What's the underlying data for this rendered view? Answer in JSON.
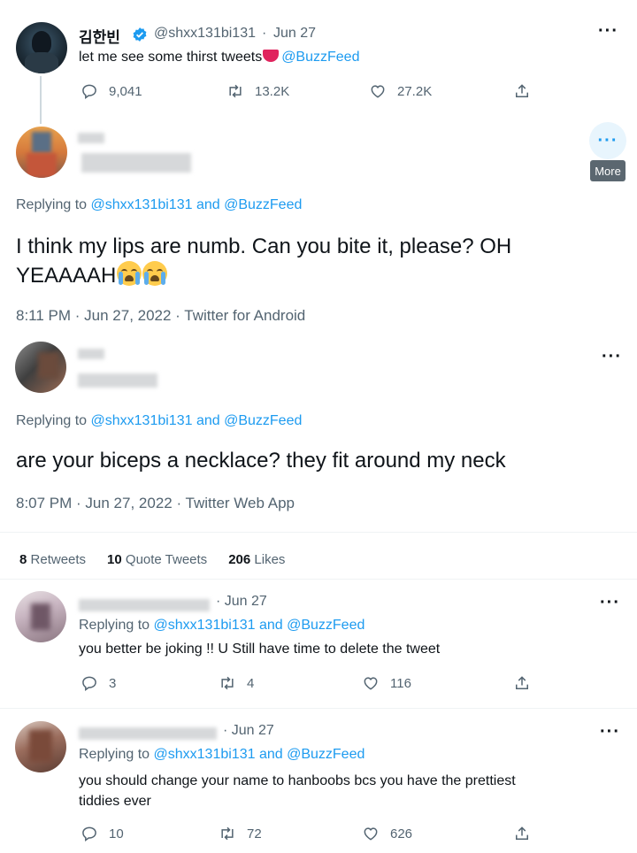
{
  "tweet1": {
    "name": "김한빈",
    "handle": "@shxx131bi131",
    "dot": "·",
    "date": "Jun 27",
    "text": "let me see some thirst tweets",
    "mention": "@BuzzFeed",
    "replies": "9,041",
    "retweets": "13.2K",
    "likes": "27.2K"
  },
  "main_tweet": {
    "replying_prefix": "Replying to",
    "replying_user1": "@shxx131bi131",
    "replying_and": "and",
    "replying_user2": "@BuzzFeed",
    "text_line1": "I think my lips are numb. Can you bite it, please? OH",
    "text_line2": "YEAAAAH",
    "timestamp": "8:11 PM · Jun 27, 2022 · Twitter for Android",
    "more_tooltip": "More"
  },
  "reply_target": {
    "replying_prefix": "Replying to",
    "replying_user1": "@shxx131bi131",
    "replying_and": "and",
    "replying_user2": "@BuzzFeed",
    "text": "are your biceps a necklace? they fit around my neck",
    "timestamp": "8:07 PM · Jun 27, 2022 · Twitter Web App"
  },
  "stats": {
    "retweets_count": "8",
    "retweets_label": "Retweets",
    "quotes_count": "10",
    "quotes_label": "Quote Tweets",
    "likes_count": "206",
    "likes_label": "Likes"
  },
  "replies": [
    {
      "date": "Jun 27",
      "replying_prefix": "Replying to",
      "replying_user1": "@shxx131bi131",
      "replying_and": "and",
      "replying_user2": "@BuzzFeed",
      "text": "you better be joking !! U Still have time to delete the tweet",
      "replies": "3",
      "retweets": "4",
      "likes": "116"
    },
    {
      "date": "Jun 27",
      "replying_prefix": "Replying to",
      "replying_user1": "@shxx131bi131",
      "replying_and": "and",
      "replying_user2": "@BuzzFeed",
      "text_line1": "you should change your name to hanboobs bcs you have the prettiest",
      "text_line2": "tiddies ever",
      "replies": "10",
      "retweets": "72",
      "likes": "626"
    }
  ],
  "colors": {
    "accent": "#1d9bf0",
    "muted": "#536471",
    "text": "#0f1419",
    "divider": "#eff3f4"
  },
  "icons": [
    "reply-icon",
    "retweet-icon",
    "like-icon",
    "share-icon",
    "more-icon",
    "verified-icon",
    "tongue-emoji",
    "crying-emoji"
  ]
}
